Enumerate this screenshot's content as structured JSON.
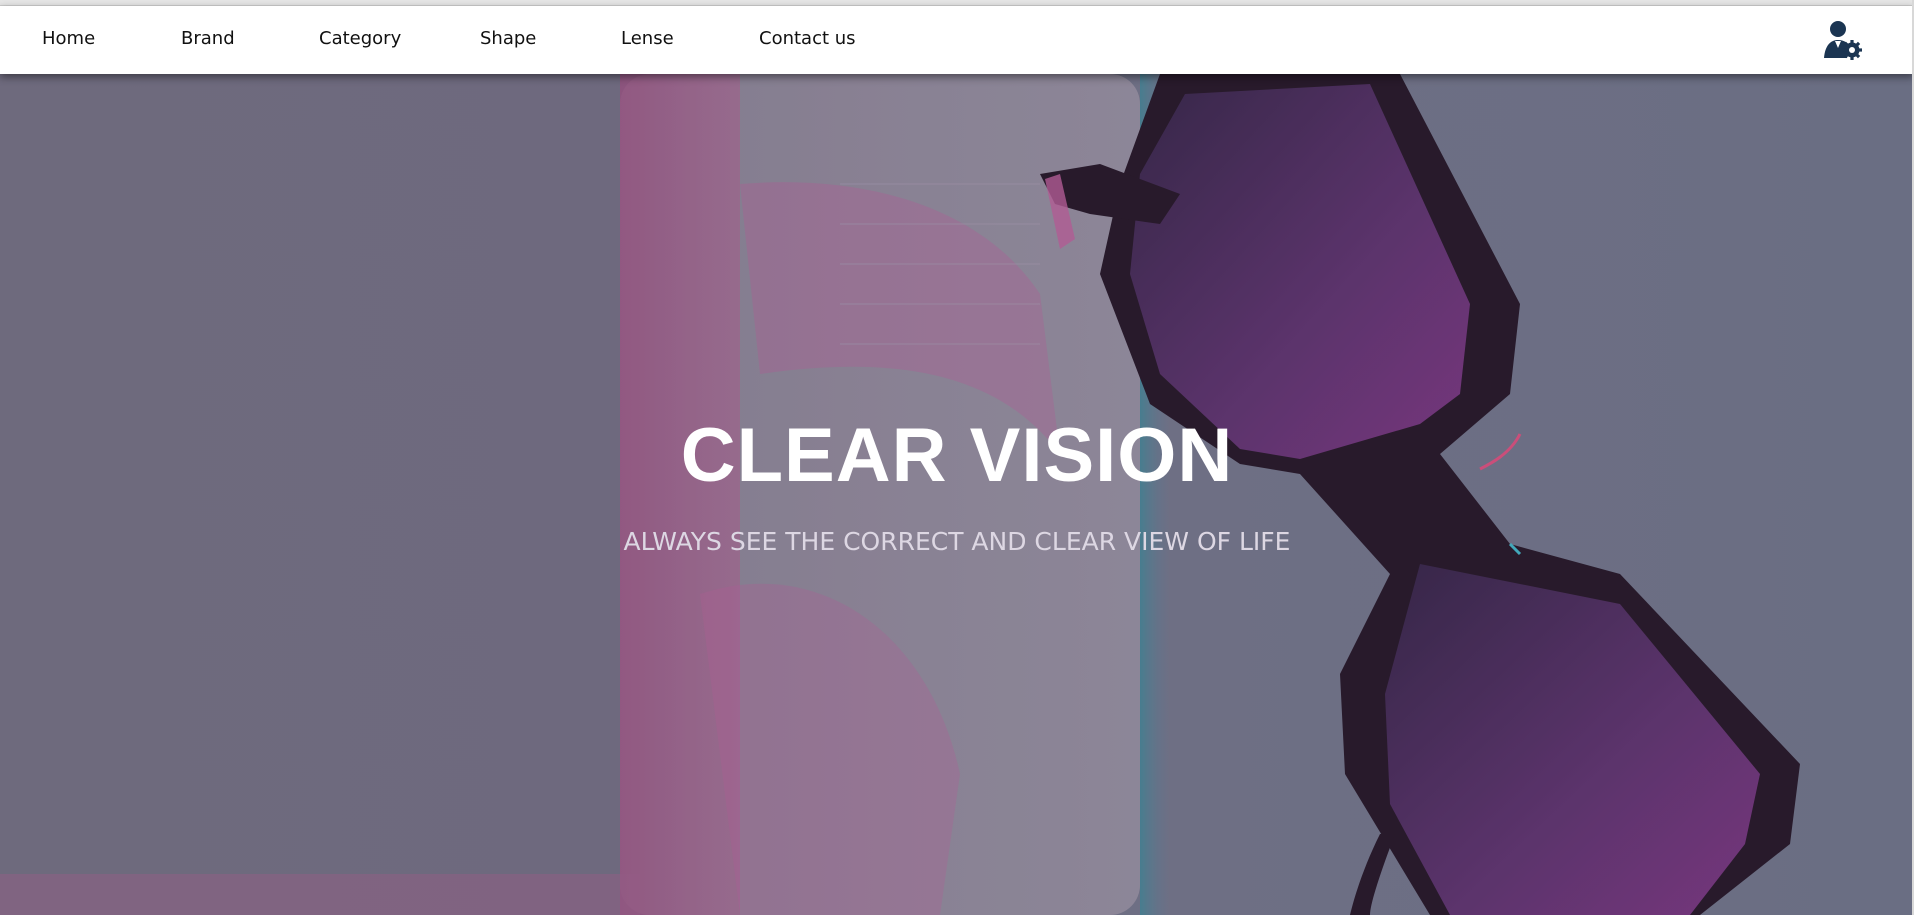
{
  "nav": {
    "items": [
      {
        "label": "Home"
      },
      {
        "label": "Brand"
      },
      {
        "label": "Category"
      },
      {
        "label": "Shape"
      },
      {
        "label": "Lense"
      },
      {
        "label": "Contact us"
      }
    ],
    "admin_icon": "user-gear-icon"
  },
  "hero": {
    "title": "CLEAR VISION",
    "subtitle": "ALWAYS SEE THE CORRECT AND CLEAR VIEW OF LIFE"
  },
  "colors": {
    "nav_bg": "#ffffff",
    "hero_overlay": "#6f6b7f",
    "accent_pink": "#c05a9a",
    "frame_dark": "#1a0a1a",
    "icon_navy": "#1b3552"
  }
}
